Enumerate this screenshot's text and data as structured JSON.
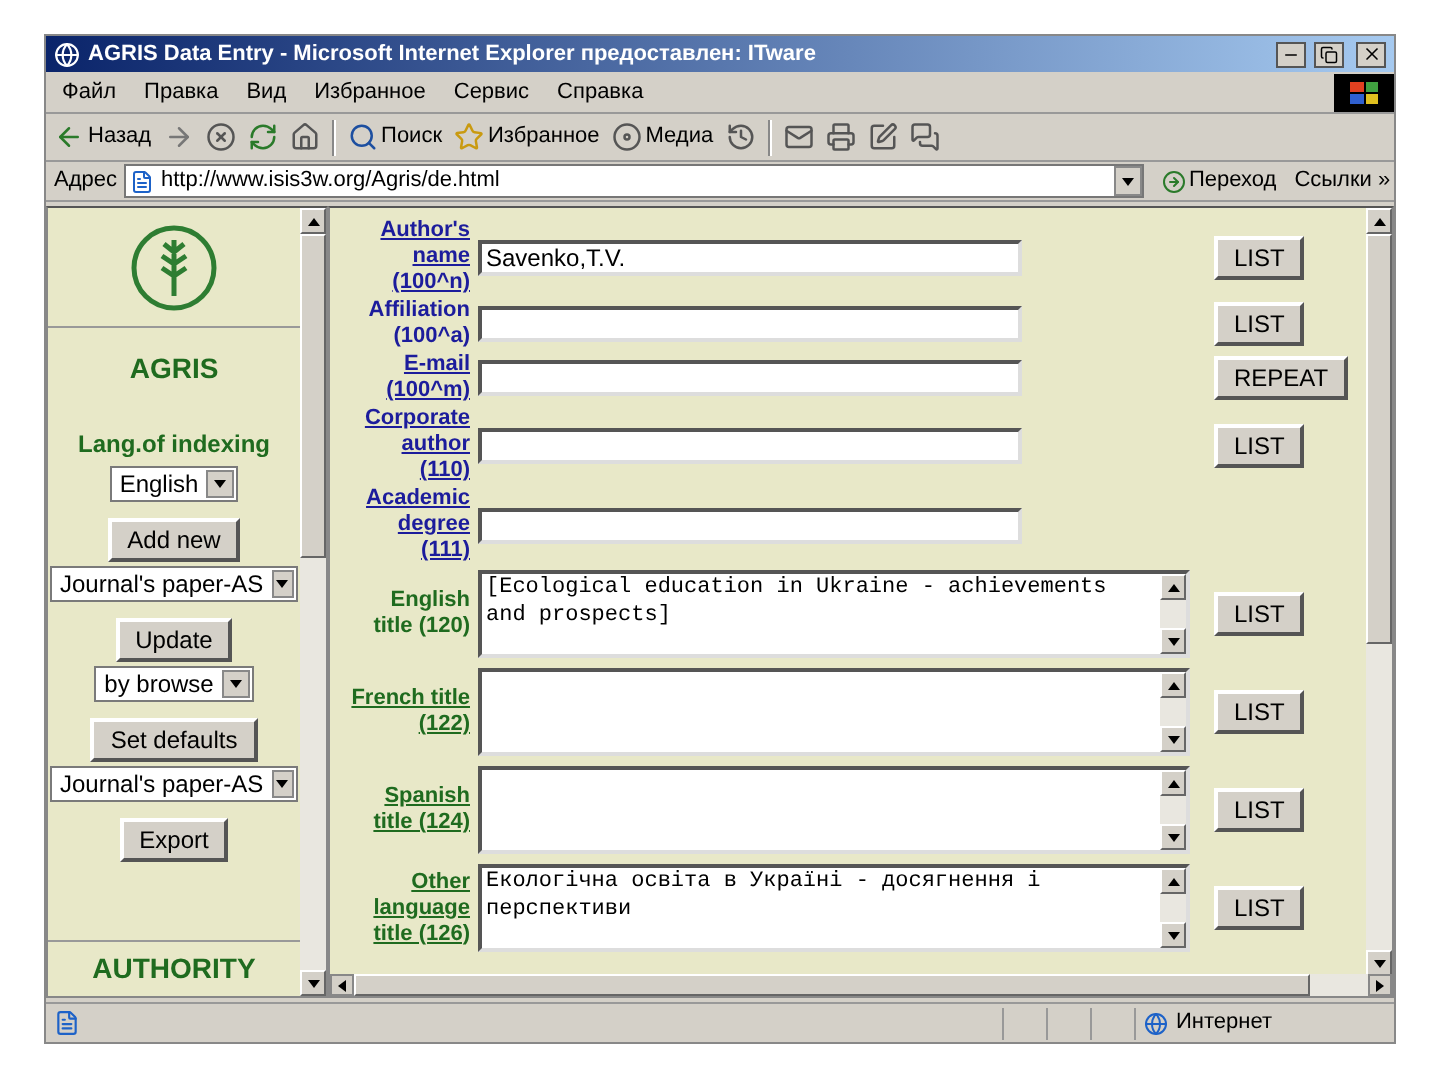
{
  "window": {
    "title": "AGRIS Data Entry - Microsoft Internet Explorer предоставлен: ITware"
  },
  "menu": [
    "Файл",
    "Правка",
    "Вид",
    "Избранное",
    "Сервис",
    "Справка"
  ],
  "toolbar": [
    {
      "kind": "back",
      "label": "Назад"
    },
    {
      "kind": "forward"
    },
    {
      "kind": "stop"
    },
    {
      "kind": "refresh"
    },
    {
      "kind": "home"
    },
    {
      "kind": "search",
      "label": "Поиск"
    },
    {
      "kind": "favorites",
      "label": "Избранное"
    },
    {
      "kind": "media",
      "label": "Медиа"
    },
    {
      "kind": "history"
    },
    {
      "kind": "mail"
    },
    {
      "kind": "print"
    },
    {
      "kind": "edit"
    },
    {
      "kind": "discuss"
    }
  ],
  "address": {
    "label": "Адрес",
    "url": "http://www.isis3w.org/Agris/de.html",
    "go": "Переход",
    "links": "Ссылки",
    "more": "»"
  },
  "sidebar": {
    "title": "AGRIS",
    "lang_label": "Lang.of indexing",
    "lang": "English",
    "actions": [
      {
        "label": "Add new",
        "select": "Journal's paper-AS"
      },
      {
        "label": "Update",
        "select": "by browse"
      },
      {
        "label": "Set defaults",
        "select": "Journal's paper-AS"
      },
      {
        "label": "Export"
      }
    ],
    "footer": "AUTHORITY"
  },
  "form": {
    "fields": [
      {
        "kind": "line",
        "label": "Author's name (100^n)",
        "link": true,
        "color": "#1c1c9c",
        "value": "Savenko,T.V.",
        "button": "LIST"
      },
      {
        "kind": "line",
        "label": "Affiliation (100^a)",
        "link": false,
        "color": "#1c1c9c",
        "button": "LIST"
      },
      {
        "kind": "line",
        "label": "E-mail (100^m)",
        "link": true,
        "color": "#1c1c9c",
        "button": "REPEAT"
      },
      {
        "kind": "line",
        "label": "Corporate author (110)",
        "link": true,
        "color": "#1c1c9c",
        "button": "LIST"
      },
      {
        "kind": "line",
        "label": "Academic degree (111)",
        "link": true,
        "color": "#1c1c9c"
      },
      {
        "kind": "box",
        "label": "English title (120)",
        "link": false,
        "color": "#1f6b1f",
        "value": "[Ecological education in Ukraine - achievements and prospects]",
        "button": "LIST"
      },
      {
        "kind": "box",
        "label": "French title (122)",
        "link": true,
        "color": "#1f6b1f",
        "button": "LIST"
      },
      {
        "kind": "box",
        "label": "Spanish title (124)",
        "link": true,
        "color": "#1f6b1f",
        "button": "LIST"
      },
      {
        "kind": "box",
        "label": "Other language title (126)",
        "link": true,
        "color": "#1f6b1f",
        "value": "Екологічна освіта в Україні - досягнення і перспективи",
        "button": "LIST"
      }
    ]
  },
  "status_bar": {
    "zone": "Интернет"
  }
}
